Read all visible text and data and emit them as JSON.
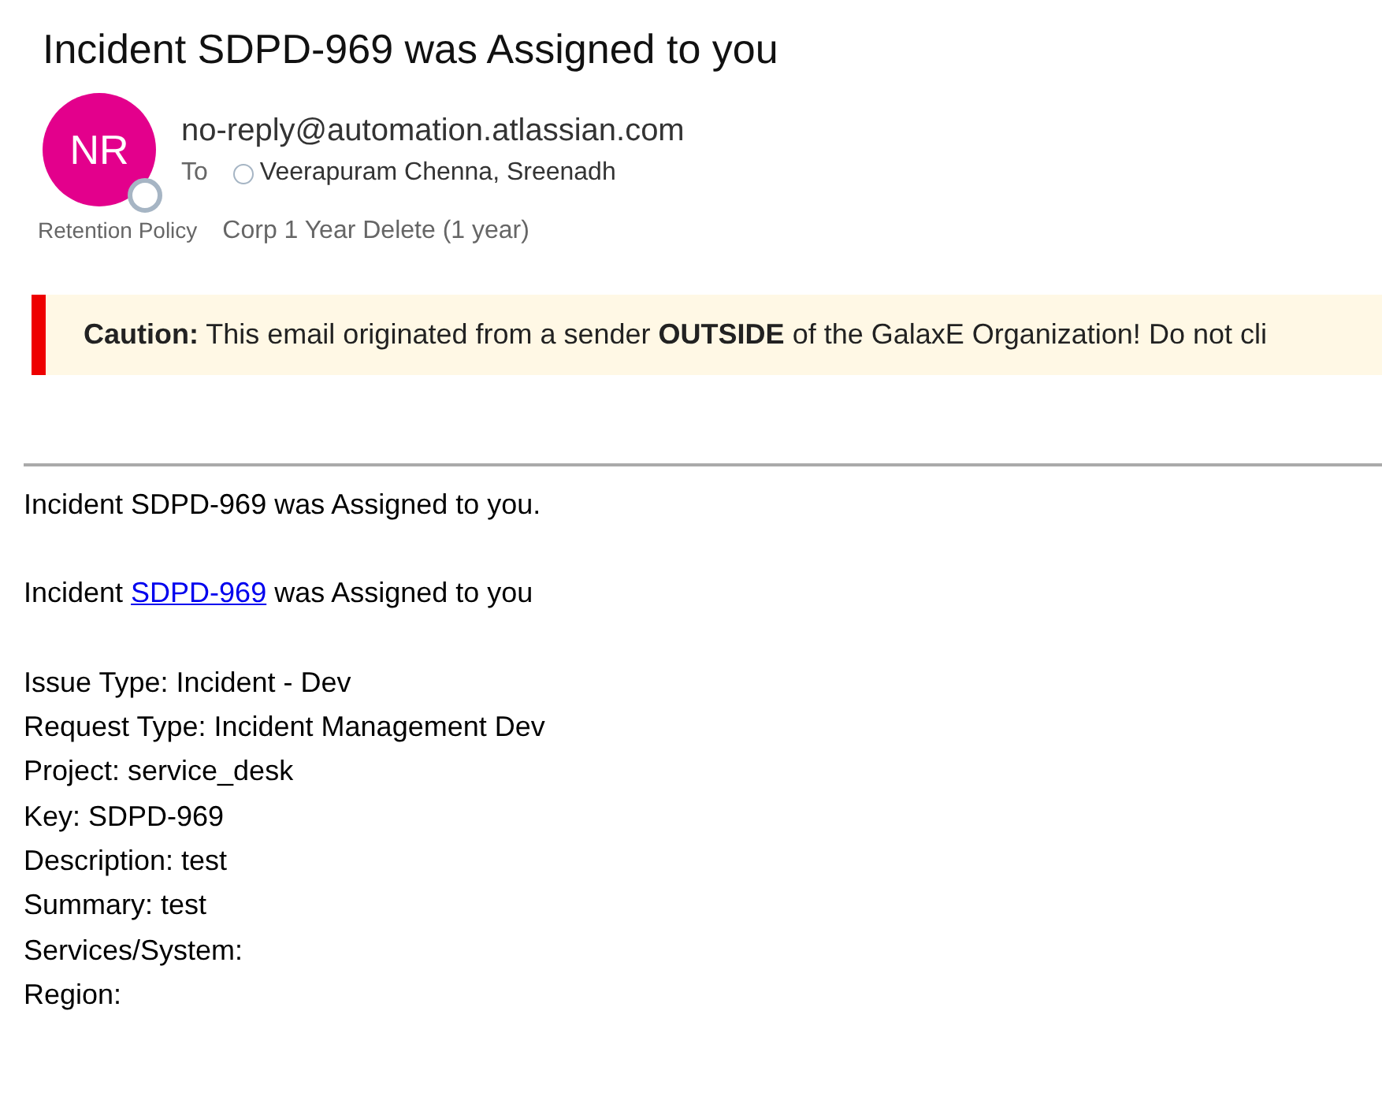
{
  "subject": "Incident SDPD-969 was Assigned to you",
  "sender": {
    "initials": "NR",
    "address": "no-reply@automation.atlassian.com",
    "to_label": "To",
    "recipient": "Veerapuram Chenna, Sreenadh"
  },
  "retention": {
    "label": "Retention Policy",
    "value": "Corp 1 Year Delete (1 year)"
  },
  "caution": "**Caution:** This email originated from a sender **OUTSIDE** of the GalaxE Organization! Do not cli",
  "body": {
    "intro": "Incident SDPD-969 was Assigned to you.",
    "link_line": {
      "before": "Incident",
      "link": "SDPD-969",
      "after": "was Assigned to you"
    },
    "fields": [
      "Issue Type: Incident - Dev",
      "Request Type: Incident Management Dev",
      "Project: service_desk",
      "Key: SDPD-969",
      "Description: test",
      "Summary: test",
      "Services/System:",
      "Region:"
    ]
  }
}
